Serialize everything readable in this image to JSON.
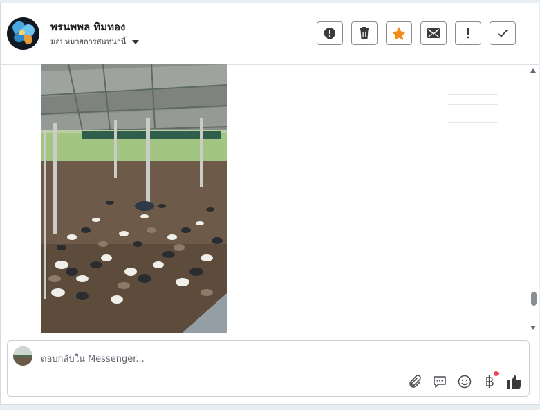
{
  "contact": {
    "name": "พรนพพล ทิมทอง",
    "assign_label": "มอบหมายการสนทนานี้"
  },
  "toolbar": {
    "buttons": [
      {
        "name": "spam-button",
        "icon": "alert-circle-icon"
      },
      {
        "name": "delete-button",
        "icon": "trash-icon"
      },
      {
        "name": "star-button",
        "icon": "star-icon",
        "color": "#f28b1b"
      },
      {
        "name": "mark-unread-button",
        "icon": "envelope-icon"
      },
      {
        "name": "follow-up-button",
        "icon": "exclamation-icon"
      },
      {
        "name": "mark-done-button",
        "icon": "check-icon"
      }
    ]
  },
  "message": {
    "attachment": "photo"
  },
  "composer": {
    "placeholder": "ตอบกลับใน Messenger...",
    "tools": [
      "paperclip-icon",
      "saved-reply-icon",
      "emoji-icon",
      "baht-payment-icon",
      "thumbs-up-icon"
    ]
  },
  "colors": {
    "accent_star": "#f28b1b",
    "notification_dot": "#e8475f",
    "icon": "#4b4f56"
  }
}
